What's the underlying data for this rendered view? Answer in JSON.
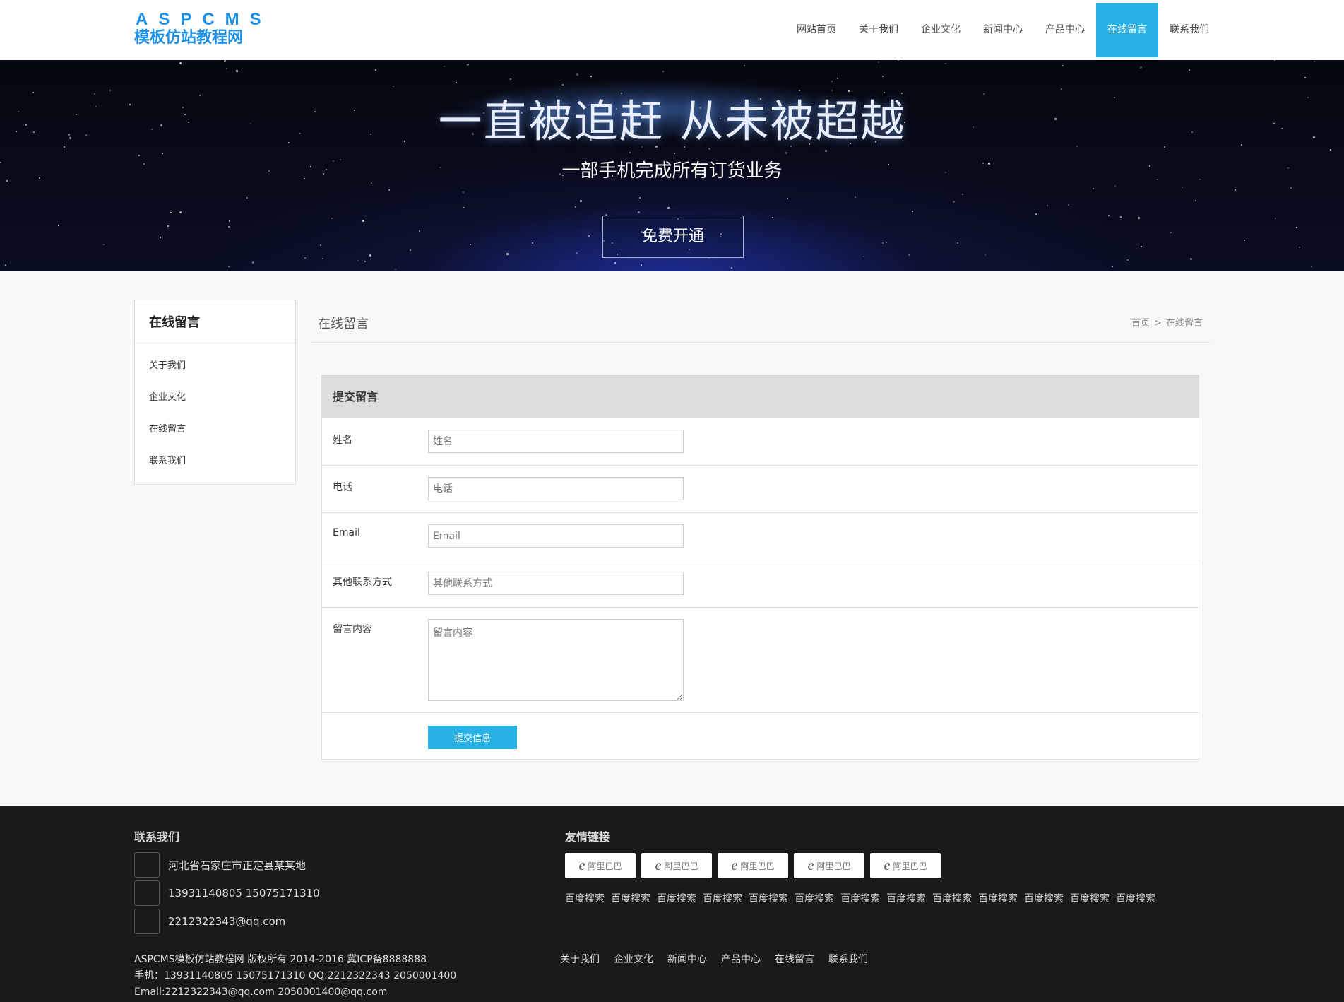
{
  "header": {
    "logo_line1": "ASPCMS",
    "logo_line2": "模板仿站教程网",
    "nav": [
      {
        "label": "网站首页",
        "active": false
      },
      {
        "label": "关于我们",
        "active": false
      },
      {
        "label": "企业文化",
        "active": false
      },
      {
        "label": "新闻中心",
        "active": false
      },
      {
        "label": "产品中心",
        "active": false
      },
      {
        "label": "在线留言",
        "active": true
      },
      {
        "label": "联系我们",
        "active": false
      }
    ],
    "accent_color": "#28b1e4"
  },
  "banner": {
    "title": "一直被追赶 从未被超越",
    "subtitle": "一部手机完成所有订货业务",
    "button_label": "免费开通"
  },
  "sidebar": {
    "title": "在线留言",
    "items": [
      {
        "label": "关于我们"
      },
      {
        "label": "企业文化"
      },
      {
        "label": "在线留言"
      },
      {
        "label": "联系我们"
      }
    ]
  },
  "main": {
    "title": "在线留言",
    "breadcrumb": [
      "首页",
      "在线留言"
    ],
    "breadcrumb_sep": ">"
  },
  "form": {
    "header": "提交留言",
    "fields": [
      {
        "label": "姓名",
        "placeholder": "姓名",
        "value": ""
      },
      {
        "label": "电话",
        "placeholder": "电话",
        "value": ""
      },
      {
        "label": "Email",
        "placeholder": "Email",
        "value": ""
      },
      {
        "label": "其他联系方式",
        "placeholder": "其他联系方式",
        "value": ""
      },
      {
        "label": "留言内容",
        "placeholder": "留言内容",
        "value": ""
      }
    ],
    "submit_label": "提交信息"
  },
  "footer": {
    "contact_title": "联系我们",
    "contacts": [
      {
        "icon": "location-icon",
        "text": "河北省石家庄市正定县某某地"
      },
      {
        "icon": "phone-icon",
        "text": "13931140805 15075171310"
      },
      {
        "icon": "mail-icon",
        "text": "2212322343@qq.com"
      }
    ],
    "links_title": "友情链接",
    "logo_links": [
      {
        "label": "阿里巴巴"
      },
      {
        "label": "阿里巴巴"
      },
      {
        "label": "阿里巴巴"
      },
      {
        "label": "阿里巴巴"
      },
      {
        "label": "阿里巴巴"
      }
    ],
    "text_links": [
      "百度搜索",
      "百度搜索",
      "百度搜索",
      "百度搜索",
      "百度搜索",
      "百度搜索",
      "百度搜索",
      "百度搜索",
      "百度搜索",
      "百度搜索",
      "百度搜索",
      "百度搜索",
      "百度搜索"
    ],
    "copyright_lines": [
      "ASPCMS模板仿站教程网 版权所有 2014-2016 冀ICP备8888888",
      "手机：13931140805 15075171310 QQ:2212322343 2050001400",
      "Email:2212322343@qq.com 2050001400@qq.com"
    ],
    "bottom_nav": [
      "关于我们",
      "企业文化",
      "新闻中心",
      "产品中心",
      "在线留言",
      "联系我们"
    ]
  }
}
